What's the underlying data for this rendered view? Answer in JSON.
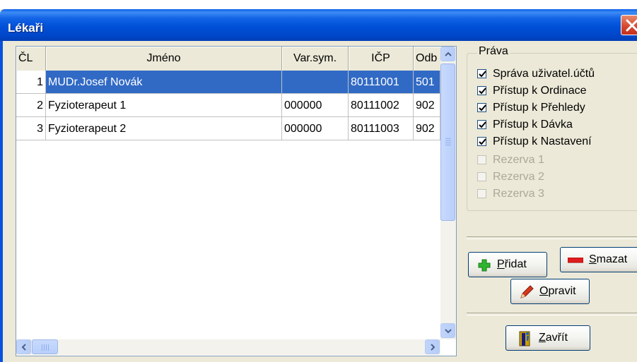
{
  "window": {
    "title": "Lékaři"
  },
  "grid": {
    "columns": [
      "ČL",
      "Jméno",
      "Var.sym.",
      "IČP",
      "Odb"
    ],
    "rows": [
      {
        "cl": "1",
        "jmeno": "MUDr.Josef Novák",
        "varsym": "",
        "icp": "80111001",
        "odb": "501",
        "selected": true
      },
      {
        "cl": "2",
        "jmeno": "Fyzioterapeut 1",
        "varsym": "000000",
        "icp": "80111002",
        "odb": "902",
        "selected": false
      },
      {
        "cl": "3",
        "jmeno": "Fyzioterapeut 2",
        "varsym": "000000",
        "icp": "80111003",
        "odb": "902",
        "selected": false
      }
    ]
  },
  "rights": {
    "title": "Práva",
    "items": [
      {
        "label": "Správa uživatel.účtů",
        "checked": true,
        "enabled": true
      },
      {
        "label": "Přístup k Ordinace",
        "checked": true,
        "enabled": true
      },
      {
        "label": "Přístup k Přehledy",
        "checked": true,
        "enabled": true
      },
      {
        "label": "Přístup k Dávka",
        "checked": true,
        "enabled": true
      },
      {
        "label": "Přístup k Nastavení",
        "checked": true,
        "enabled": true
      },
      {
        "label": "Rezerva 1",
        "checked": false,
        "enabled": false
      },
      {
        "label": "Rezerva 2",
        "checked": false,
        "enabled": false
      },
      {
        "label": "Rezerva 3",
        "checked": false,
        "enabled": false
      }
    ]
  },
  "buttons": {
    "add": {
      "mnemonic": "P",
      "rest": "řidat"
    },
    "delete": {
      "mnemonic": "S",
      "rest": "mazat"
    },
    "edit": {
      "mnemonic": "O",
      "rest": "pravit"
    },
    "close": {
      "mnemonic": "Z",
      "rest": "avřít"
    }
  },
  "colors": {
    "selection": "#316ac5",
    "titlebar": "#0050d8"
  }
}
